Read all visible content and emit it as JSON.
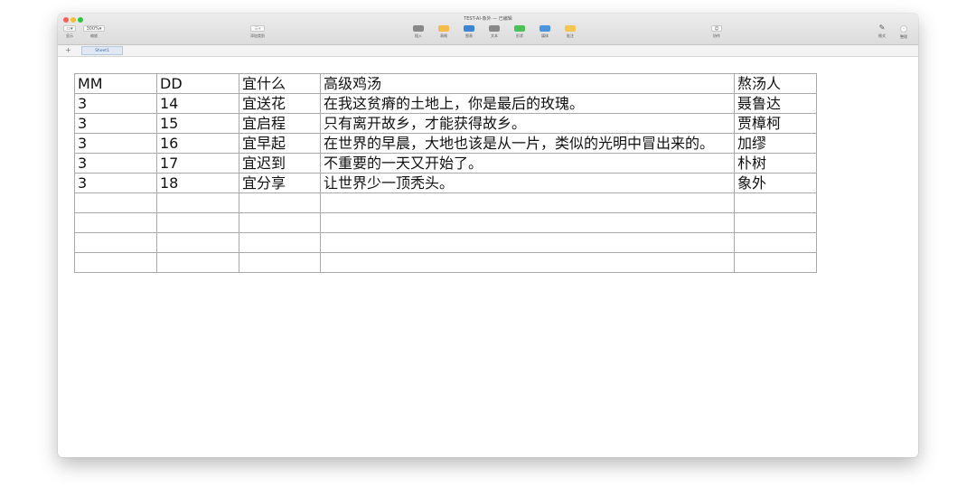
{
  "window": {
    "title": "TEST-AI-象外 — 已编辑"
  },
  "toolbar": {
    "view_label": "显示",
    "zoom_value": "300%",
    "zoom_label": "缩放",
    "add_category_label": "添加类别",
    "center_items": [
      {
        "label": "插入",
        "icon": "insert-icon",
        "color": "#7f7f7f"
      },
      {
        "label": "表格",
        "icon": "table-icon",
        "color": "#f6b73c"
      },
      {
        "label": "图表",
        "icon": "chart-icon",
        "color": "#2b7bd6"
      },
      {
        "label": "文本",
        "icon": "text-icon",
        "color": "#7f7f7f"
      },
      {
        "label": "形状",
        "icon": "shape-icon",
        "color": "#3bbf4a"
      },
      {
        "label": "媒体",
        "icon": "media-icon",
        "color": "#3a8de0"
      },
      {
        "label": "批注",
        "icon": "comment-icon",
        "color": "#f6c340"
      }
    ],
    "collaborate_label": "协作",
    "format_label": "格式",
    "organize_label": "整理"
  },
  "sheets": {
    "add_symbol": "+",
    "active_sheet": "Sheet1"
  },
  "table": {
    "rows": [
      [
        "MM",
        "DD",
        "宜什么",
        "高级鸡汤",
        "熬汤人"
      ],
      [
        "3",
        "14",
        "宜送花",
        "在我这贫瘠的土地上，你是最后的玫瑰。",
        "聂鲁达"
      ],
      [
        "3",
        "15",
        "宜启程",
        "只有离开故乡，才能获得故乡。",
        "贾樟柯"
      ],
      [
        "3",
        "16",
        "宜早起",
        "在世界的早晨，大地也该是从一片，类似的光明中冒出来的。",
        "加缪"
      ],
      [
        "3",
        "17",
        "宜迟到",
        "不重要的一天又开始了。",
        "朴树"
      ],
      [
        "3",
        "18",
        "宜分享",
        "让世界少一顶秃头。",
        "象外"
      ],
      [
        "",
        "",
        "",
        "",
        ""
      ],
      [
        "",
        "",
        "",
        "",
        ""
      ],
      [
        "",
        "",
        "",
        "",
        ""
      ],
      [
        "",
        "",
        "",
        "",
        ""
      ]
    ]
  }
}
